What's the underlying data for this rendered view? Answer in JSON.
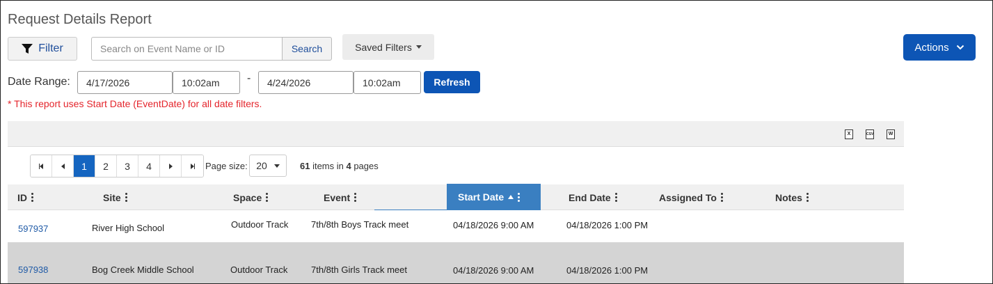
{
  "page": {
    "title": "Request Details Report"
  },
  "toolbar": {
    "filter_label": "Filter",
    "search_placeholder": "Search on Event Name or ID",
    "search_label": "Search",
    "saved_filters_label": "Saved Filters",
    "actions_label": "Actions"
  },
  "date_range": {
    "label": "Date Range:",
    "start_date": "4/17/2026",
    "start_time": "10:02am",
    "separator": "-",
    "end_date": "4/24/2026",
    "end_time": "10:02am",
    "refresh_label": "Refresh",
    "note": "* This report uses Start Date (EventDate) for all date filters."
  },
  "export": {
    "excel": "X",
    "csv": "CSV",
    "word": "W"
  },
  "pager": {
    "pages": [
      "1",
      "2",
      "3",
      "4"
    ],
    "current_page": "1",
    "page_size_label": "Page size:",
    "page_size": "20",
    "total_items": "61",
    "items_text": " items in ",
    "total_pages": "4",
    "pages_text": " pages"
  },
  "columns": [
    "ID",
    "Site",
    "Space",
    "Event",
    "Start Date",
    "End Date",
    "Assigned To",
    "Notes"
  ],
  "sorted_column": "Start Date",
  "rows": [
    {
      "id": "597937",
      "site": "River High School",
      "space": "Outdoor Track",
      "event": "7th/8th Boys Track meet",
      "start": "04/18/2026 9:00 AM",
      "end": "04/18/2026 1:00 PM",
      "assigned": "",
      "notes": ""
    },
    {
      "id": "597938",
      "site": "Bog Creek Middle School",
      "space": "Outdoor Track",
      "event": "7th/8th Girls Track meet",
      "start": "04/18/2026 9:00 AM",
      "end": "04/18/2026 1:00 PM",
      "assigned": "",
      "notes": ""
    }
  ],
  "colors": {
    "primary": "#0d55b5",
    "sorted_header": "#3a7fc1",
    "link": "#1f5aa6",
    "note": "#e4242b",
    "selected_row": "#d4d4d4"
  }
}
